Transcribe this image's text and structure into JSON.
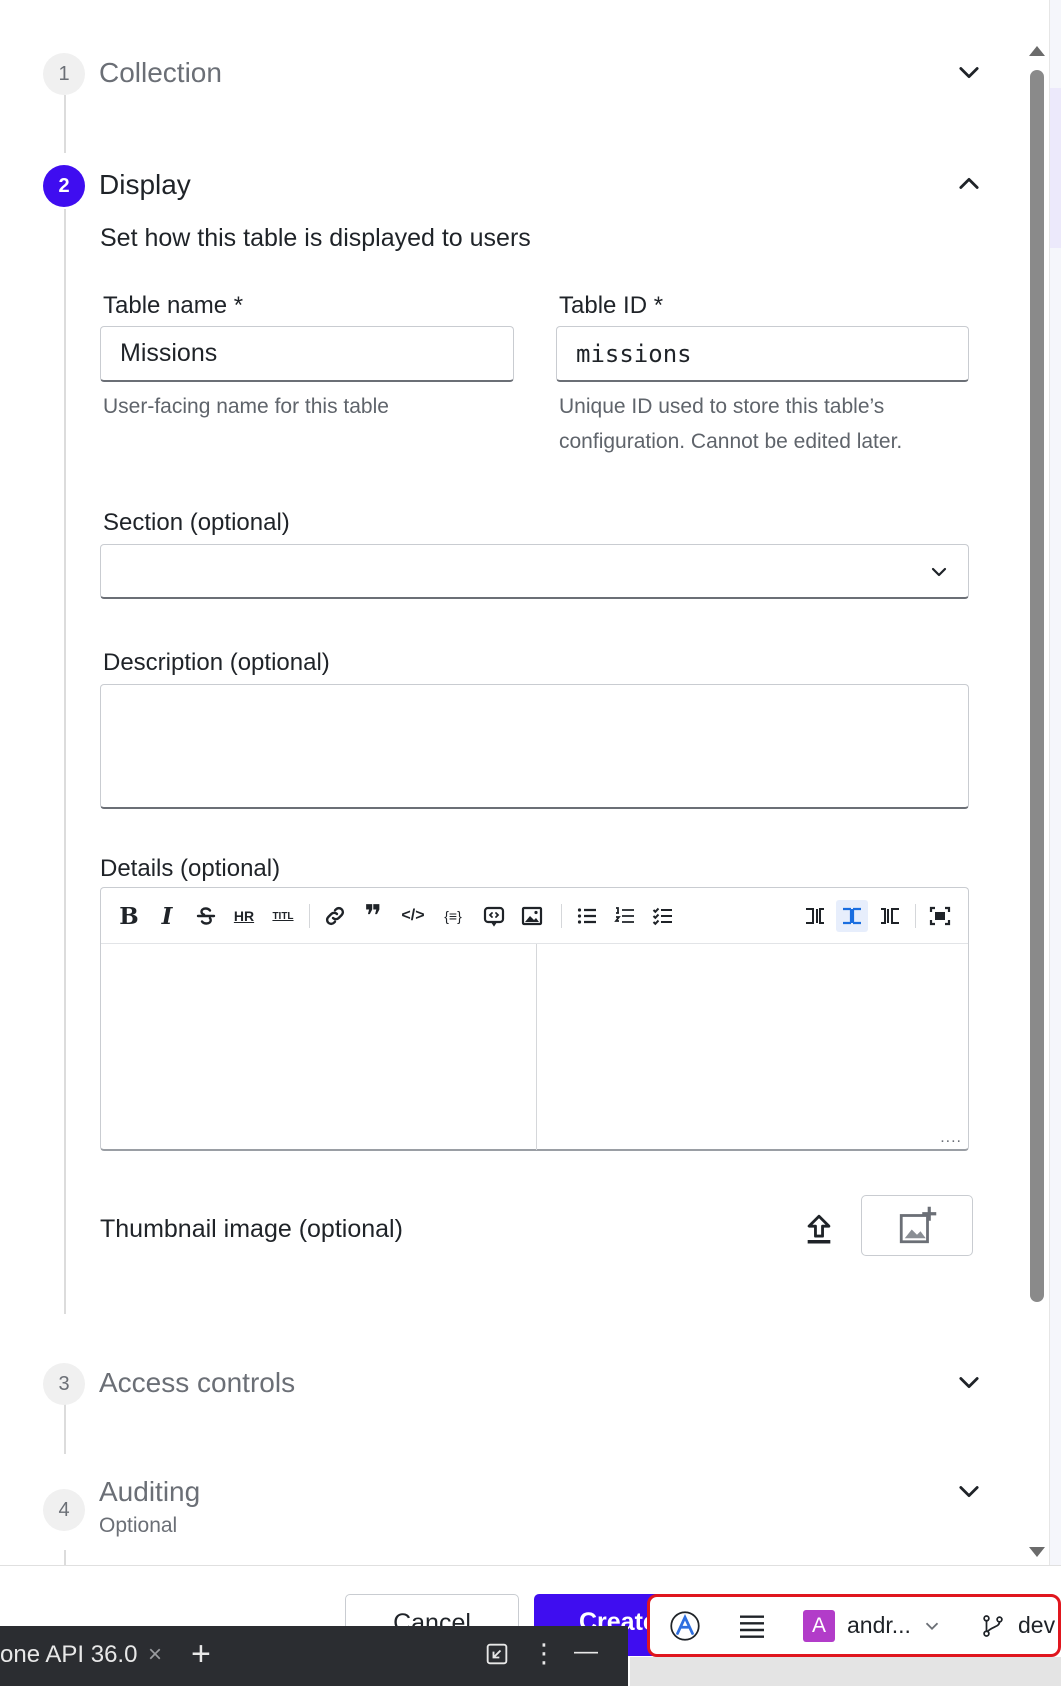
{
  "steps": [
    {
      "number": "1",
      "title": "Collection"
    },
    {
      "number": "2",
      "title": "Display",
      "subtitle": "Set how this table is displayed to users"
    },
    {
      "number": "3",
      "title": "Access controls"
    },
    {
      "number": "4",
      "title": "Auditing",
      "subtitle": "Optional"
    }
  ],
  "form": {
    "table_name": {
      "label": "Table name *",
      "value": "Missions",
      "help": "User-facing name for this table"
    },
    "table_id": {
      "label": "Table ID *",
      "value": "missions",
      "help_line1": "Unique ID used to store this table’s",
      "help_line2": "configuration. Cannot be edited later."
    },
    "section": {
      "label": "Section (optional)",
      "value": ""
    },
    "description": {
      "label": "Description (optional)",
      "value": ""
    },
    "details": {
      "label": "Details (optional)",
      "resize_hint": "...."
    },
    "thumbnail": {
      "label": "Thumbnail image (optional)"
    }
  },
  "toolbar": {
    "bold": "B",
    "italic": "I",
    "hr": "HR",
    "title": "TITL",
    "quote": "❞",
    "code": "</>",
    "code_block": "{≡}"
  },
  "footer": {
    "cancel_label": "Cancel",
    "create_label": "Create"
  },
  "taskbar": {
    "tab_label": "one API 36.0",
    "close": "×",
    "add": "+",
    "menu": "⋮",
    "minimize": "—"
  },
  "devbar": {
    "user_initial": "A",
    "user_name": "andr...",
    "branch": "dev"
  },
  "colors": {
    "accent": "#3f0df0",
    "highlight_border": "#e0161e"
  }
}
